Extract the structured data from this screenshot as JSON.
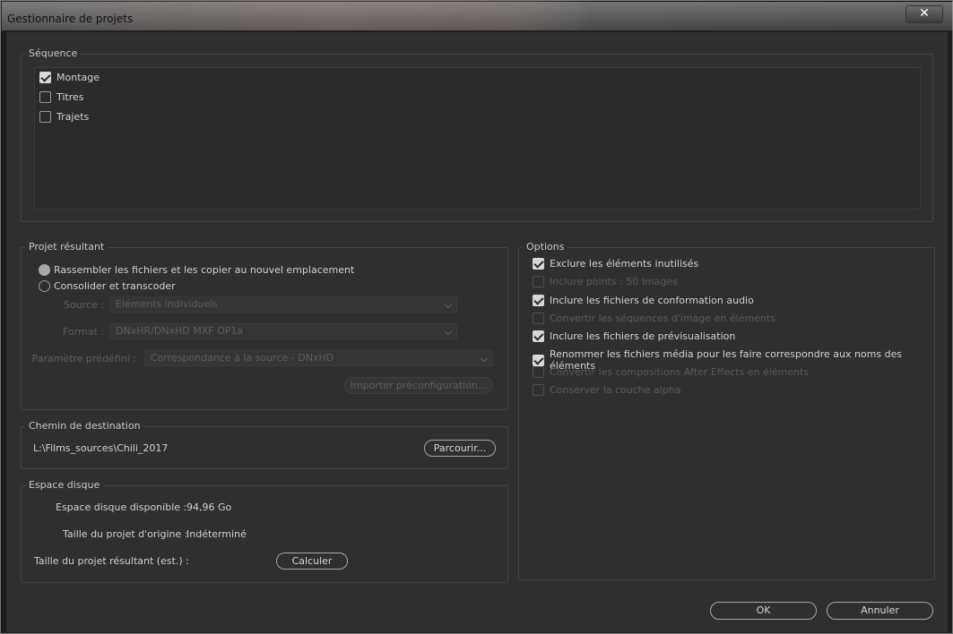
{
  "window": {
    "title": "Gestionnaire de projets",
    "close_glyph": "✕"
  },
  "sequence": {
    "legend": "Séquence",
    "items": [
      {
        "label": "Montage",
        "checked": true
      },
      {
        "label": "Titres",
        "checked": false
      },
      {
        "label": "Trajets",
        "checked": false
      }
    ]
  },
  "resulting_project": {
    "legend": "Projet résultant",
    "option_collect": "Rassembler les fichiers et les copier au nouvel emplacement",
    "option_consolidate": "Consolider et transcoder",
    "source_label": "Source :",
    "source_value": "Eléments individuels",
    "format_label": "Format :",
    "format_value": "DNxHR/DNxHD MXF OP1a",
    "preset_label": "Paramètre prédéfini :",
    "preset_value": "Correspondance à la source - DNxHD",
    "import_preset_button": "Importer préconfiguration..."
  },
  "destination": {
    "legend": "Chemin de destination",
    "path": "L:\\Films_sources\\Chili_2017",
    "browse_button": "Parcourir..."
  },
  "disk": {
    "legend": "Espace disque",
    "available_label": "Espace disque disponible :",
    "available_value": "94,96 Go",
    "original_size_label": "Taille du projet d'origine :",
    "original_size_value": "Indéterminé",
    "result_size_label": "Taille du projet résultant (est.) :",
    "compute_button": "Calculer"
  },
  "options": {
    "legend": "Options",
    "items": [
      {
        "label": "Exclure les éléments inutilisés",
        "checked": true,
        "disabled": false
      },
      {
        "label": "Inclure points :  50 Images",
        "checked": false,
        "disabled": true
      },
      {
        "label": "Inclure les fichiers de conformation audio",
        "checked": true,
        "disabled": false
      },
      {
        "label": "Convertir les séquences d'image en éléments",
        "checked": false,
        "disabled": true
      },
      {
        "label": "Inclure les fichiers de prévisualisation",
        "checked": true,
        "disabled": false
      },
      {
        "label": "Renommer les fichiers média pour les faire correspondre aux noms des éléments",
        "checked": true,
        "disabled": false
      },
      {
        "label": "Convertir les compositions After Effects en éléments",
        "checked": false,
        "disabled": true
      },
      {
        "label": "Conserver la couche alpha",
        "checked": false,
        "disabled": true
      }
    ]
  },
  "footer": {
    "ok_button": "OK",
    "cancel_button": "Annuler"
  }
}
